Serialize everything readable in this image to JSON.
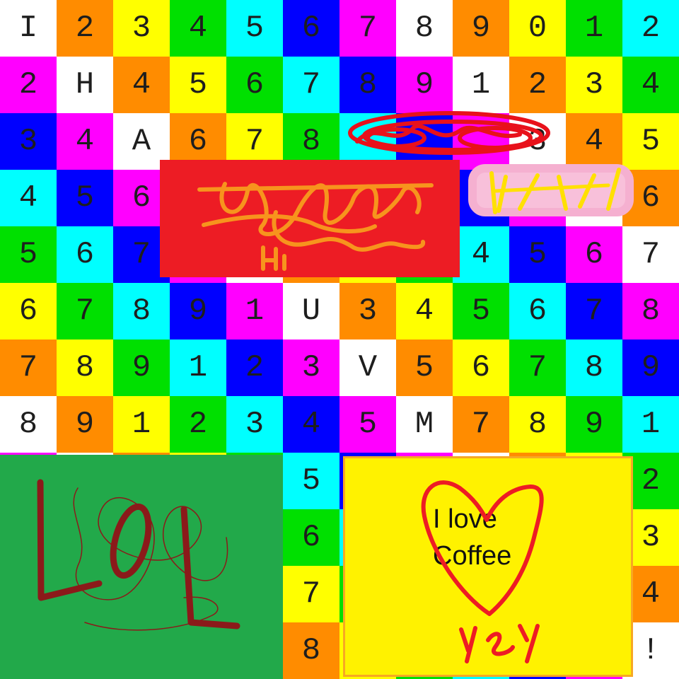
{
  "grid": {
    "rows": [
      [
        "I",
        "2",
        "3",
        "4",
        "5",
        "6",
        "7",
        "8",
        "9",
        "0",
        "1",
        "2"
      ],
      [
        "2",
        "H",
        "4",
        "5",
        "6",
        "7",
        "8",
        "9",
        "1",
        "2",
        "3",
        "4"
      ],
      [
        "3",
        "4",
        "A",
        "6",
        "7",
        "8",
        "",
        "",
        "",
        "3",
        "4",
        "5"
      ],
      [
        "4",
        "5",
        "6",
        "",
        "",
        "",
        "",
        "",
        "",
        "",
        "",
        "6"
      ],
      [
        "5",
        "6",
        "7",
        "",
        "",
        "",
        "",
        "",
        "4",
        "5",
        "6",
        "7"
      ],
      [
        "6",
        "7",
        "8",
        "9",
        "1",
        "U",
        "3",
        "4",
        "5",
        "6",
        "7",
        "8"
      ],
      [
        "7",
        "8",
        "9",
        "1",
        "2",
        "3",
        "V",
        "5",
        "6",
        "7",
        "8",
        "9"
      ],
      [
        "8",
        "9",
        "1",
        "2",
        "3",
        "4",
        "5",
        "M",
        "7",
        "8",
        "9",
        "1"
      ],
      [
        "",
        "",
        "",
        "",
        "",
        "5",
        "",
        "",
        "",
        "",
        "",
        "2"
      ],
      [
        "",
        "",
        "",
        "",
        "",
        "6",
        "",
        "",
        "",
        "",
        "",
        "3"
      ],
      [
        "",
        "",
        "",
        "",
        "",
        "7",
        "",
        "",
        "",
        "",
        "",
        "4"
      ],
      [
        "",
        "",
        "",
        "",
        "",
        "8",
        "",
        "",
        "",
        "",
        "",
        "!"
      ]
    ],
    "colors": [
      [
        "#ffffff",
        "#ff8c00",
        "#ffff00",
        "#00e000",
        "#00ffff",
        "#0000ff",
        "#ff00ff",
        "#ffffff",
        "#ff8c00",
        "#ffff00",
        "#00e000",
        "#00ffff"
      ],
      [
        "#ff00ff",
        "#ffffff",
        "#ff8c00",
        "#ffff00",
        "#00e000",
        "#00ffff",
        "#0000ff",
        "#ff00ff",
        "#ffffff",
        "#ff8c00",
        "#ffff00",
        "#00e000"
      ],
      [
        "#0000ff",
        "#ff00ff",
        "#ffffff",
        "#ff8c00",
        "#ffff00",
        "#00e000",
        "#00ffff",
        "#0000ff",
        "#ff00ff",
        "#ffffff",
        "#ff8c00",
        "#ffff00"
      ],
      [
        "#00ffff",
        "#0000ff",
        "#ff00ff",
        "#ffffff",
        "#ff8c00",
        "#ffff00",
        "#00e000",
        "#00ffff",
        "#0000ff",
        "#ff00ff",
        "#ffffff",
        "#ff8c00"
      ],
      [
        "#00e000",
        "#00ffff",
        "#0000ff",
        "#ff00ff",
        "#ffffff",
        "#ff8c00",
        "#ffff00",
        "#00e000",
        "#00ffff",
        "#0000ff",
        "#ff00ff",
        "#ffffff"
      ],
      [
        "#ffff00",
        "#00e000",
        "#00ffff",
        "#0000ff",
        "#ff00ff",
        "#ffffff",
        "#ff8c00",
        "#ffff00",
        "#00e000",
        "#00ffff",
        "#0000ff",
        "#ff00ff"
      ],
      [
        "#ff8c00",
        "#ffff00",
        "#00e000",
        "#00ffff",
        "#0000ff",
        "#ff00ff",
        "#ffffff",
        "#ff8c00",
        "#ffff00",
        "#00e000",
        "#00ffff",
        "#0000ff"
      ],
      [
        "#ffffff",
        "#ff8c00",
        "#ffff00",
        "#00e000",
        "#00ffff",
        "#0000ff",
        "#ff00ff",
        "#ffffff",
        "#ff8c00",
        "#ffff00",
        "#00e000",
        "#00ffff"
      ],
      [
        "#ff00ff",
        "#ffffff",
        "#ff8c00",
        "#ffff00",
        "#00e000",
        "#00ffff",
        "#0000ff",
        "#ff00ff",
        "#ffffff",
        "#ff8c00",
        "#ffff00",
        "#00e000"
      ],
      [
        "#0000ff",
        "#ff00ff",
        "#ffffff",
        "#ff8c00",
        "#ffff00",
        "#00e000",
        "#00ffff",
        "#0000ff",
        "#ff00ff",
        "#ffffff",
        "#ff8c00",
        "#ffff00"
      ],
      [
        "#00ffff",
        "#0000ff",
        "#ff00ff",
        "#ffffff",
        "#ff8c00",
        "#ffff00",
        "#00e000",
        "#00ffff",
        "#0000ff",
        "#ff00ff",
        "#ffffff",
        "#ff8c00"
      ],
      [
        "#00e000",
        "#00ffff",
        "#0000ff",
        "#ff00ff",
        "#ffffff",
        "#ff8c00",
        "#ffff00",
        "#00e000",
        "#00ffff",
        "#0000ff",
        "#ff00ff",
        "#ffffff"
      ]
    ]
  },
  "overlays": {
    "red_box_color": "#ed1c24",
    "green_box_color": "#22a94a",
    "yellow_box_color": "#fff200",
    "coffee_line_1": "I love",
    "coffee_line_2": "Coffee"
  },
  "doodles": {
    "hi_text": "Hi",
    "lol_text": "LOL",
    "yey_text": "yey"
  }
}
